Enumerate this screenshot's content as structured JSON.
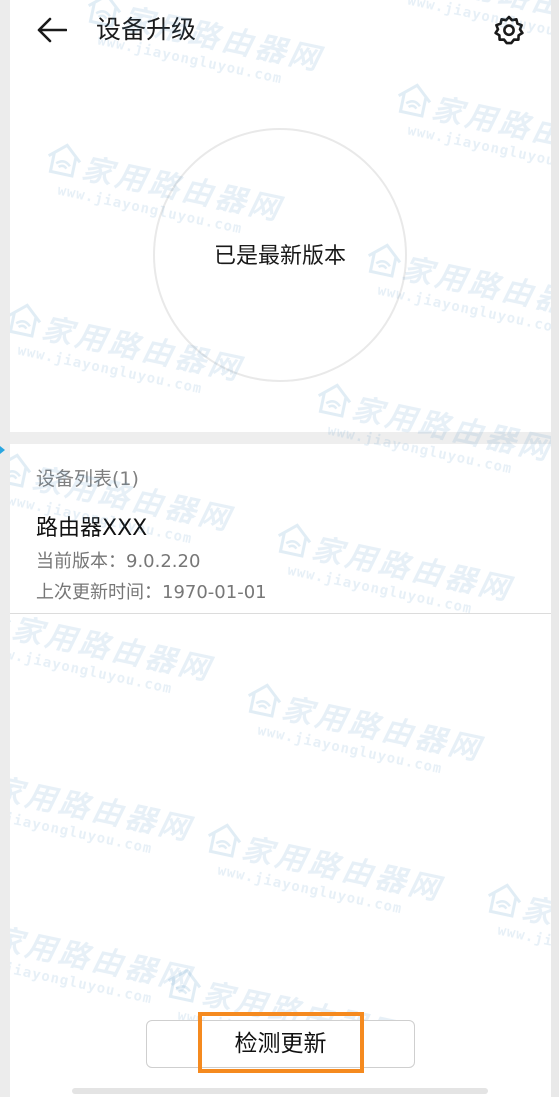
{
  "header": {
    "title": "设备升级",
    "back_icon": "arrow-left-icon",
    "settings_icon": "gear-icon"
  },
  "status": {
    "text": "已是最新版本"
  },
  "device_list": {
    "header": "设备列表(1)",
    "devices": [
      {
        "name": "路由器XXX",
        "current_version": "当前版本：9.0.2.20",
        "last_update": "上次更新时间：1970-01-01"
      }
    ]
  },
  "actions": {
    "check_update_label": "检测更新"
  },
  "watermark": {
    "brand": "家用路由器网",
    "url": "www.jiayongluyou.com"
  },
  "colors": {
    "highlight": "#f58a1f",
    "watermark": "#468cbe"
  }
}
